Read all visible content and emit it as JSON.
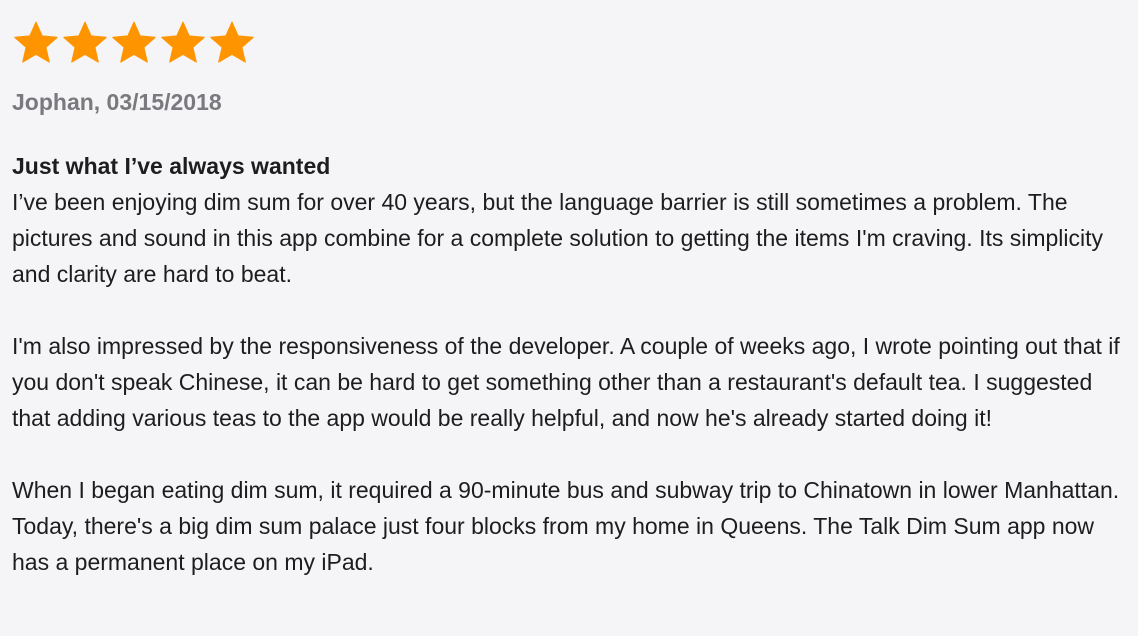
{
  "review": {
    "rating": 5,
    "rating_max": 5,
    "star_icon": "filled-star-icon",
    "star_color": "#fe9500",
    "reviewer_line": "Jophan, 03/15/2018",
    "title": "Just what I’ve always wanted",
    "paragraphs": [
      "I’ve been enjoying dim sum for over 40 years, but the language barrier is still sometimes a problem. The pictures and sound in this app combine for a complete solution to getting the items I'm craving. Its simplicity and clarity are hard to beat.",
      "I'm also impressed by the responsiveness of the developer. A couple of weeks ago, I wrote pointing out that if you don't speak Chinese, it can be hard to get something other than a restaurant's default tea. I suggested that adding various teas to the app would be really helpful, and now he's already started doing it!",
      "When I began eating dim sum, it required a 90-minute bus and subway trip to Chinatown in lower Manhattan. Today, there's a big dim sum palace just four blocks from my home in Queens. The Talk Dim Sum app now has a permanent place on my iPad."
    ]
  },
  "colors": {
    "background": "#f5f5f7",
    "text": "#1d1d1f",
    "meta_text": "#7a7a7e"
  }
}
